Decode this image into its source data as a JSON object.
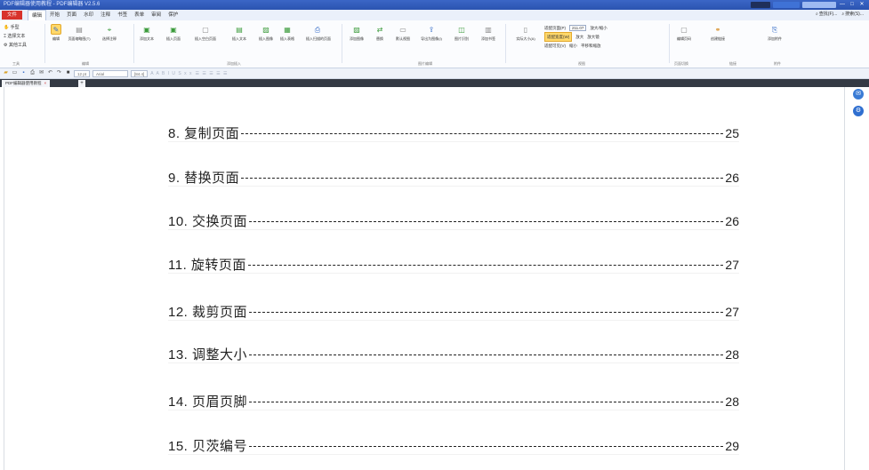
{
  "window": {
    "title": "PDF编辑器使用教程 - PDF编辑器 V2.5.6",
    "controls": [
      "—",
      "□",
      "✕"
    ]
  },
  "menubar": {
    "file": "文件",
    "items": [
      "编辑",
      "开始",
      "页面",
      "水印",
      "注释",
      "书签",
      "表单",
      "审阅",
      "保护"
    ],
    "active_index": 0,
    "right": [
      "查找(F)...",
      "搜索(S)..."
    ]
  },
  "ribbon": {
    "small_tools": [
      "手型",
      "选择文本",
      "其他工具"
    ],
    "buttons": [
      "编辑",
      "页面缩略图(T)",
      "选择注释",
      "添加文本",
      "插入页面",
      "插入空白页面",
      "插入文本",
      "插入图像",
      "插入表格",
      "插入扫描的页面",
      "添加图像",
      "替换",
      "默认视图",
      "导出为图像(I)",
      "图片识别",
      "添加书签",
      "实际大小(A)",
      "编辑页码",
      "创建链接",
      "添加附件"
    ],
    "groups": [
      "工具",
      "编辑",
      "添加插入",
      "图片编辑",
      "视图",
      "页面切换",
      "链接",
      "附件"
    ],
    "zoom": {
      "fit_page": "适配页面(P)",
      "zoom_value": "211.07",
      "fit_width": "适配宽度(W)",
      "fit_visible": "适配可见(V)",
      "zoom_in": "放大",
      "zoom_out": "缩小",
      "magnifier": "放大/缩小",
      "loupe": "放大镜",
      "pan_zoom": "平移和缩放"
    }
  },
  "formatbar": {
    "font_size": "12 pt",
    "font_name": "Arial",
    "char_scale": "[84.4]",
    "format_glyphs": "A A B I U S x x"
  },
  "tabs": {
    "doc": "PDF编辑器使用教程",
    "close": "×",
    "add": "+"
  },
  "toc": [
    {
      "label": "8. 复制页面",
      "page": "25"
    },
    {
      "label": "9. 替换页面",
      "page": "26"
    },
    {
      "label": "10. 交换页面",
      "page": "26"
    },
    {
      "label": "11. 旋转页面",
      "page": "27"
    },
    {
      "label": "12. 裁剪页面",
      "page": "27"
    },
    {
      "label": "13. 调整大小",
      "page": "28"
    },
    {
      "label": "14. 页眉页脚",
      "page": "28"
    },
    {
      "label": "15. 贝茨编号",
      "page": "29"
    }
  ]
}
